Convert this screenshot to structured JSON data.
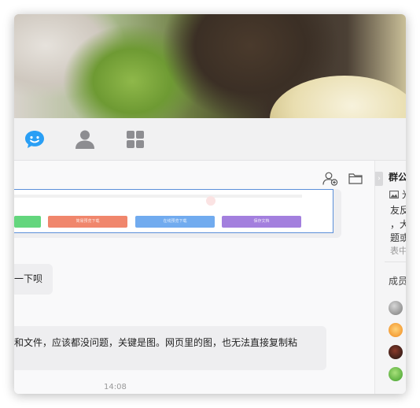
{
  "toolbar": {
    "tabs": [
      {
        "icon": "chat-bubble-icon",
        "color": "#2a9ff5"
      },
      {
        "icon": "contact-person-icon",
        "color": "#8d8d91"
      },
      {
        "icon": "apps-grid-icon",
        "color": "#8d8d91"
      }
    ]
  },
  "preview": {
    "buttons": [
      {
        "label": "",
        "color": "#63d67d"
      },
      {
        "label": "简易预览下载",
        "color": "#f0866c"
      },
      {
        "label": "在线预览下载",
        "color": "#71abef"
      },
      {
        "label": "保存文档",
        "color": "#a37fde"
      }
    ]
  },
  "messages": [
    {
      "text": "一下呗"
    },
    {
      "text": "和文件，应该都没问题，关键是图。网页里的图，也无法直接复制粘"
    }
  ],
  "timestamp": "14:08",
  "side_panel": {
    "collapse_glyph": "›",
    "title": "群公",
    "lines": [
      "光",
      "友反",
      "，大",
      "题或"
    ],
    "muted_line": "表中",
    "members_label": "成员",
    "member_avatar_colors": [
      "#9a9a9a",
      "#f08a1e",
      "#3a2a25",
      "#5bbd3a"
    ]
  }
}
